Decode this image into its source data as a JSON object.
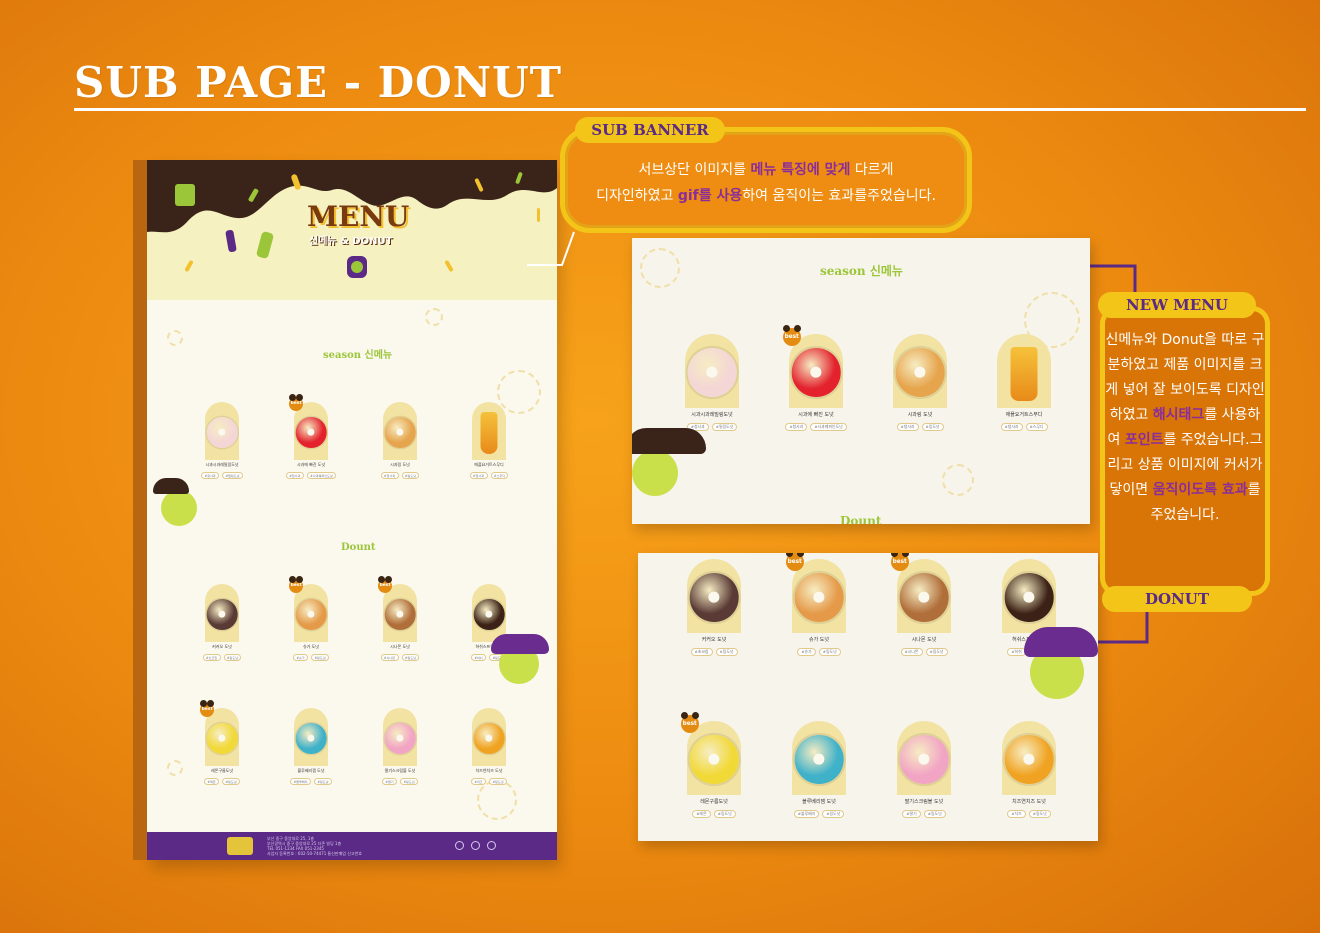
{
  "page_title": "SUB PAGE -  DONUT",
  "sub_banner": {
    "tag": "SUB BANNER",
    "line1_a": "서브상단 이미지를 ",
    "line1_hl": "메뉴 특징에 맞게",
    "line1_b": "  다르게",
    "line2_a": "디자인하였고 ",
    "line2_hl": "gif를 사용",
    "line2_b": "하여 움직이는 효과를주었습니다."
  },
  "new_menu": {
    "tag": "NEW MENU",
    "text_a": "신메뉴와 Donut을 따로 구분하였고 제품 이미지를 크게 넣어 잘 보이도록 디자인하였고 ",
    "hl1": "해시태그",
    "text_b": "를 사용하여 ",
    "hl2": "포인트",
    "text_c": "를 주었습니다.그리고 상품 이미지에 커서가 닿이면 ",
    "hl3": "움직이도록 효과",
    "text_d": "를 주었습니다."
  },
  "donut_tag": "DONUT",
  "mock": {
    "menu_logo": "MENU",
    "menu_sub": "신메뉴 & DONUT",
    "season_en": "season",
    "season_kr": "신메뉴",
    "dount": "Dount",
    "footer_lines": [
      "부산 중구 중앙대로 25, 1층",
      "부산광역시 중구 중앙대로 25 더존 빌딩 1층",
      "TEL 051-1234 FAX 051-2345",
      "사업자 등록번호 : 602-50-74471 통신판매업 신고번호"
    ]
  },
  "best_label": "best",
  "season_items": [
    {
      "name": "시과시과레밀링도넛",
      "tags": [
        "#청사과",
        "#밀링도넛"
      ],
      "color": "#f4d6d6",
      "kind": "donut"
    },
    {
      "name": "시과에 빠진 도넛",
      "tags": [
        "#청사과",
        "#사과퀘퍼인도넛"
      ],
      "color": "#e3222e",
      "kind": "donut",
      "best": true
    },
    {
      "name": "시과링 도넛",
      "tags": [
        "#청사과",
        "#링도넛"
      ],
      "color": "#e6a44c",
      "kind": "donut"
    },
    {
      "name": "애플요거트스무디",
      "tags": [
        "#청사과",
        "#스무디"
      ],
      "color": "#f3b62a",
      "kind": "cup"
    }
  ],
  "donut_items": [
    {
      "name": "커커오 도넛",
      "tags": [
        "#초코칩",
        "#링도넛"
      ],
      "color": "#5a3a35",
      "best": false
    },
    {
      "name": "슈가 도넛",
      "tags": [
        "#슈가",
        "#링도넛"
      ],
      "color": "#e59a4a",
      "best": true
    },
    {
      "name": "시나몬 도넛",
      "tags": [
        "#시나몬",
        "#링도넛"
      ],
      "color": "#b06e3a",
      "best": true
    },
    {
      "name": "허쉬스프링 도넛",
      "tags": [
        "#허쉬",
        "#링도넛"
      ],
      "color": "#3c2216",
      "best": false
    },
    {
      "name": "레몬구름도넛",
      "tags": [
        "#레몬",
        "#링도넛"
      ],
      "color": "#f1d937",
      "best": true
    },
    {
      "name": "블루베리잼 도넛",
      "tags": [
        "#블루베리",
        "#링도넛"
      ],
      "color": "#3fb1c9",
      "best": false
    },
    {
      "name": "딸기스크림볼 도넛",
      "tags": [
        "#딸기",
        "#링도넛"
      ],
      "color": "#f2a4c4",
      "best": false
    },
    {
      "name": "치즈연치즈 도넛",
      "tags": [
        "#치즈",
        "#링도넛"
      ],
      "color": "#f0a322",
      "best": false
    }
  ],
  "colors": {
    "accent_yellow": "#f4c519",
    "purple": "#5a2a86",
    "orange_bg": "#ec8a10",
    "green": "#9cc63a"
  }
}
